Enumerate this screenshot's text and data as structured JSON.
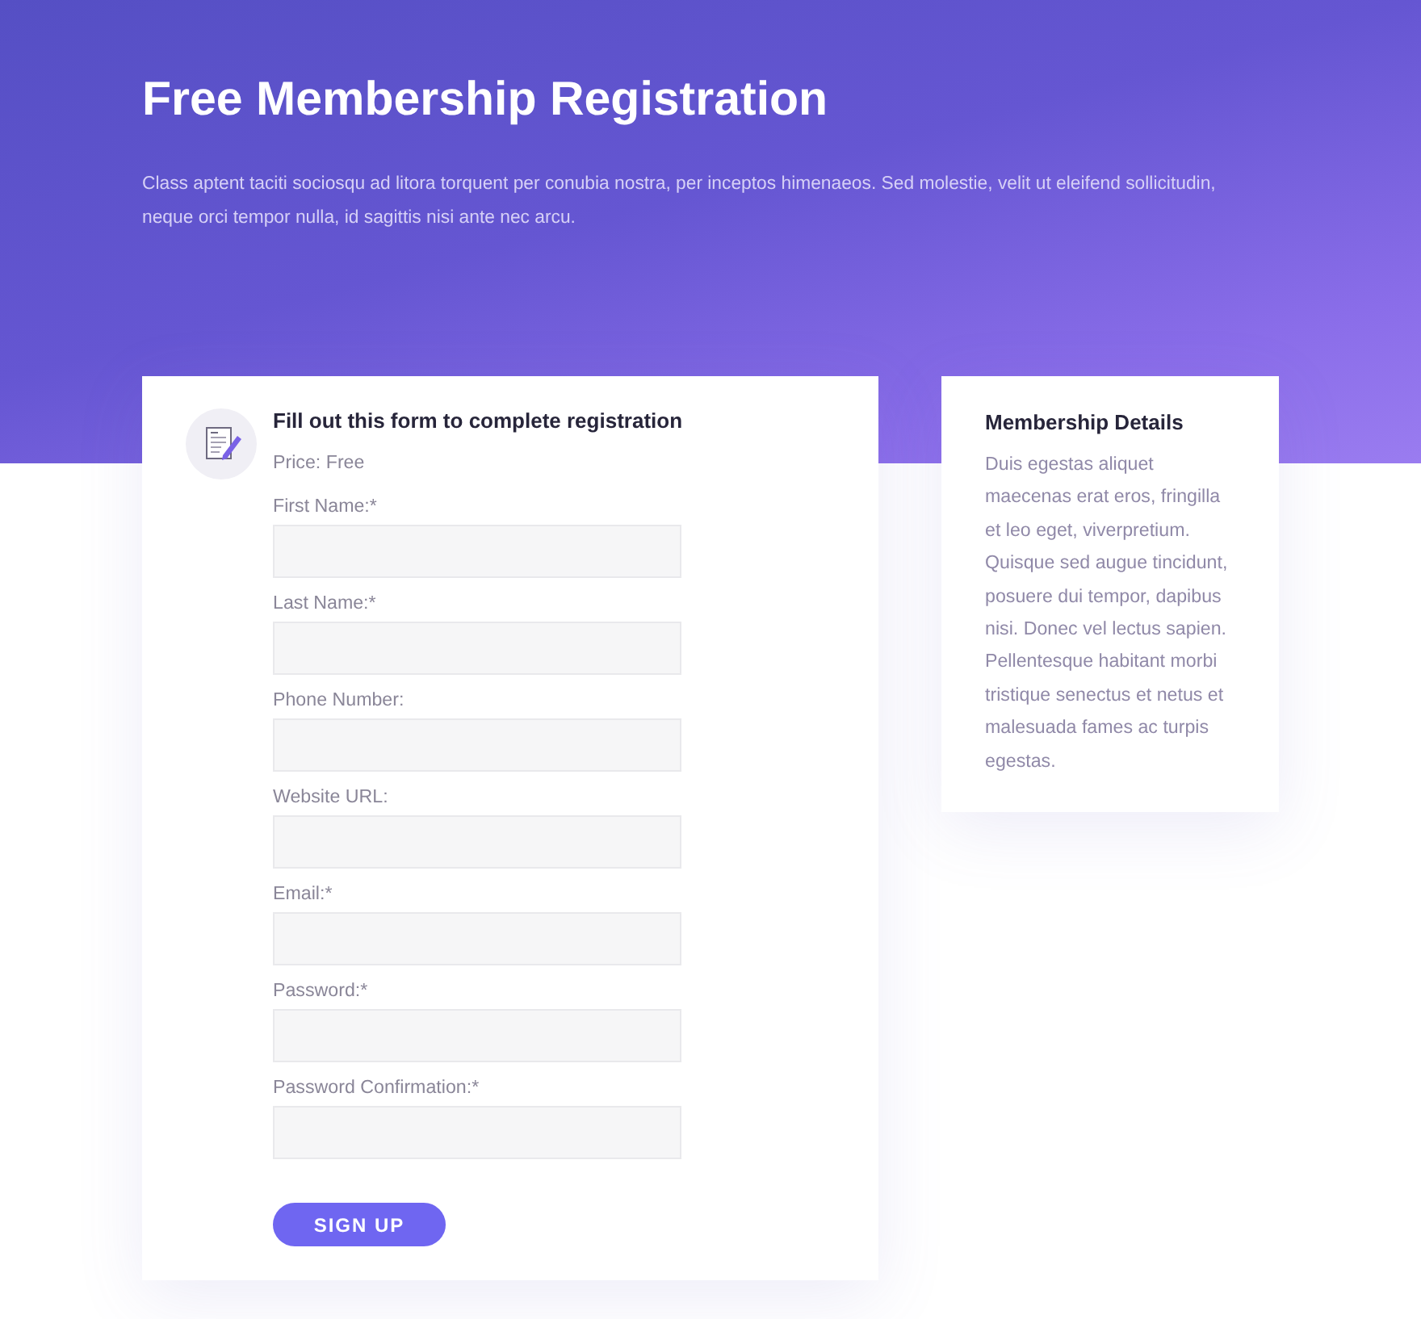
{
  "header": {
    "title": "Free Membership Registration",
    "description": "Class aptent taciti sociosqu ad litora torquent per conubia nostra, per inceptos himenaeos. Sed molestie, velit ut eleifend sollicitudin, neque orci tempor nulla, id sagittis nisi ante nec arcu."
  },
  "form": {
    "heading": "Fill out this form to complete registration",
    "price": "Price: Free",
    "fields": [
      {
        "label": "First Name:*"
      },
      {
        "label": "Last Name:*"
      },
      {
        "label": "Phone Number:"
      },
      {
        "label": "Website URL:"
      },
      {
        "label": "Email:*"
      },
      {
        "label": "Password:*"
      },
      {
        "label": "Password Confirmation:*"
      }
    ],
    "submit": "SIGN UP"
  },
  "details": {
    "title": "Membership Details",
    "text": "Duis egestas aliquet maecenas erat eros, fringilla et leo eget, viverpretium. Quisque sed augue tincidunt, posuere dui tempor, dapibus nisi. Donec vel lectus sapien. Pellentesque habitant morbi tristique senectus et netus et malesuada fames ac turpis egestas."
  }
}
